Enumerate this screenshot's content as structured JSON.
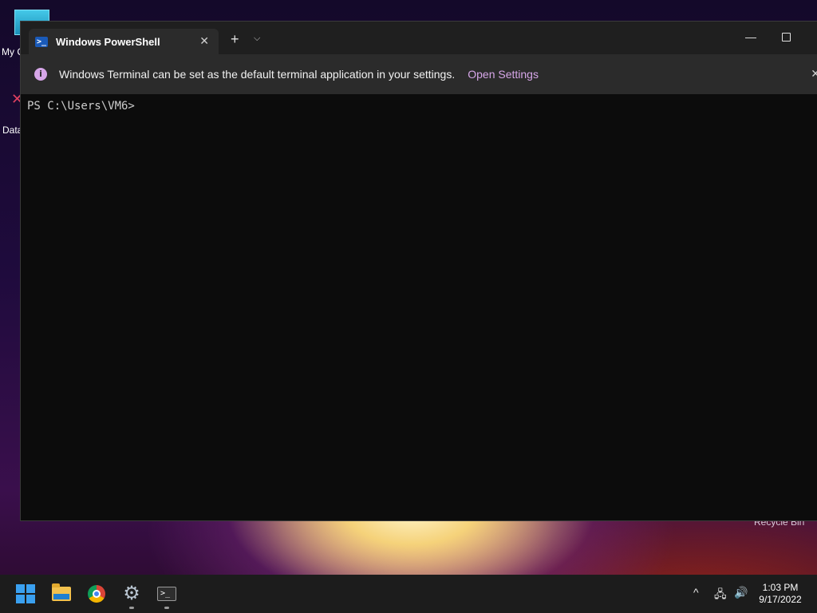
{
  "desktop": {
    "icons": [
      {
        "label": "My C"
      },
      {
        "label": "Data"
      },
      {
        "label": "Recycle Bin"
      }
    ]
  },
  "window": {
    "tab_title": "Windows PowerShell",
    "tab_close": "✕",
    "new_tab": "+",
    "dropdown": "⌵",
    "minimize": "—"
  },
  "infobar": {
    "icon": "i",
    "message": "Windows Terminal can be set as the default terminal application in your settings.",
    "link": "Open Settings",
    "close": "✕"
  },
  "console": {
    "prompt": "PS C:\\Users\\VM6>"
  },
  "taskbar": {
    "apps": [
      "start",
      "file-explorer",
      "chrome",
      "settings",
      "terminal"
    ],
    "tray": {
      "chevron": "^",
      "time": "1:03 PM",
      "date": "9/17/2022"
    }
  }
}
